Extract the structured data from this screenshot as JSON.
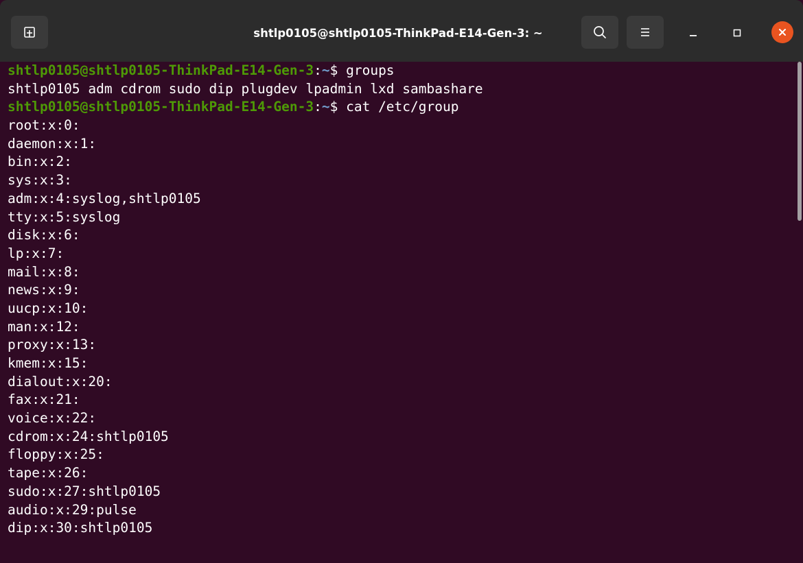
{
  "window": {
    "title": "shtlp0105@shtlp0105-ThinkPad-E14-Gen-3: ~"
  },
  "icons": {
    "new_tab": "new-tab-icon",
    "search": "search-icon",
    "menu": "hamburger-menu-icon",
    "minimize": "minimize-icon",
    "maximize": "maximize-icon",
    "close": "close-icon"
  },
  "colors": {
    "terminal_bg": "#300a24",
    "prompt_user": "#4e9a06",
    "prompt_path": "#729fcf",
    "close_button": "#e95420"
  },
  "terminal": {
    "prompt": {
      "user_host": "shtlp0105@shtlp0105-ThinkPad-E14-Gen-3",
      "colon": ":",
      "path": "~",
      "symbol": "$ "
    },
    "lines": [
      {
        "type": "prompt",
        "command": "groups"
      },
      {
        "type": "output",
        "text": "shtlp0105 adm cdrom sudo dip plugdev lpadmin lxd sambashare"
      },
      {
        "type": "prompt",
        "command": "cat /etc/group"
      },
      {
        "type": "output",
        "text": "root:x:0:"
      },
      {
        "type": "output",
        "text": "daemon:x:1:"
      },
      {
        "type": "output",
        "text": "bin:x:2:"
      },
      {
        "type": "output",
        "text": "sys:x:3:"
      },
      {
        "type": "output",
        "text": "adm:x:4:syslog,shtlp0105"
      },
      {
        "type": "output",
        "text": "tty:x:5:syslog"
      },
      {
        "type": "output",
        "text": "disk:x:6:"
      },
      {
        "type": "output",
        "text": "lp:x:7:"
      },
      {
        "type": "output",
        "text": "mail:x:8:"
      },
      {
        "type": "output",
        "text": "news:x:9:"
      },
      {
        "type": "output",
        "text": "uucp:x:10:"
      },
      {
        "type": "output",
        "text": "man:x:12:"
      },
      {
        "type": "output",
        "text": "proxy:x:13:"
      },
      {
        "type": "output",
        "text": "kmem:x:15:"
      },
      {
        "type": "output",
        "text": "dialout:x:20:"
      },
      {
        "type": "output",
        "text": "fax:x:21:"
      },
      {
        "type": "output",
        "text": "voice:x:22:"
      },
      {
        "type": "output",
        "text": "cdrom:x:24:shtlp0105"
      },
      {
        "type": "output",
        "text": "floppy:x:25:"
      },
      {
        "type": "output",
        "text": "tape:x:26:"
      },
      {
        "type": "output",
        "text": "sudo:x:27:shtlp0105"
      },
      {
        "type": "output",
        "text": "audio:x:29:pulse"
      },
      {
        "type": "output",
        "text": "dip:x:30:shtlp0105"
      }
    ]
  }
}
